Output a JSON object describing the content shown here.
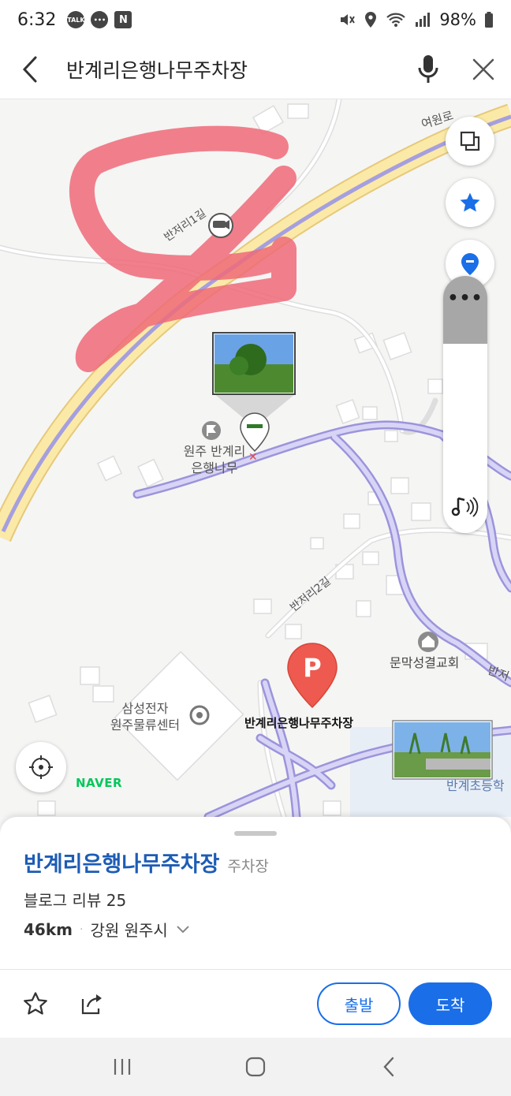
{
  "status": {
    "time": "6:32",
    "notif_talk": "TALK",
    "notif_n": "N",
    "battery": "98%",
    "icons": [
      "talk-icon",
      "chat-icon",
      "naver-app-icon",
      "mute-icon",
      "location-icon",
      "wifi-icon",
      "signal-icon",
      "battery-icon"
    ]
  },
  "search": {
    "query": "반계리은행나무주차장"
  },
  "map": {
    "road_labels": {
      "yeowon": "여원로",
      "banjeo1": "반저리1길",
      "banjeo2": "반저리2길",
      "banjeo_right": "반저"
    },
    "poi_tree_line1": "원주 반계리",
    "poi_tree_line2": "은행나무",
    "poi_church": "문막성결교회",
    "poi_samsung_line1": "삼성전자",
    "poi_samsung_line2": "원주물류센터",
    "poi_school": "반계초등학",
    "parking_marker_letter": "P",
    "parking_name": "반계리은행나무주차장",
    "logo": "NAVER",
    "side_menu_dots": "•••"
  },
  "place": {
    "name": "반계리은행나무주차장",
    "category": "주차장",
    "review": "블로그 리뷰 25",
    "distance": "46km",
    "separator": "·",
    "region": "강원 원주시"
  },
  "actions": {
    "depart": "출발",
    "arrive": "도착"
  },
  "colors": {
    "accent": "#1a6ee8",
    "title_blue": "#1d5cb5",
    "road_purple": "#a59fe0",
    "highway_yellow": "#fbe9a7",
    "scribble_red": "#ee6a78",
    "naver_green": "#03c75a",
    "marker_red": "#ee5a4f"
  }
}
